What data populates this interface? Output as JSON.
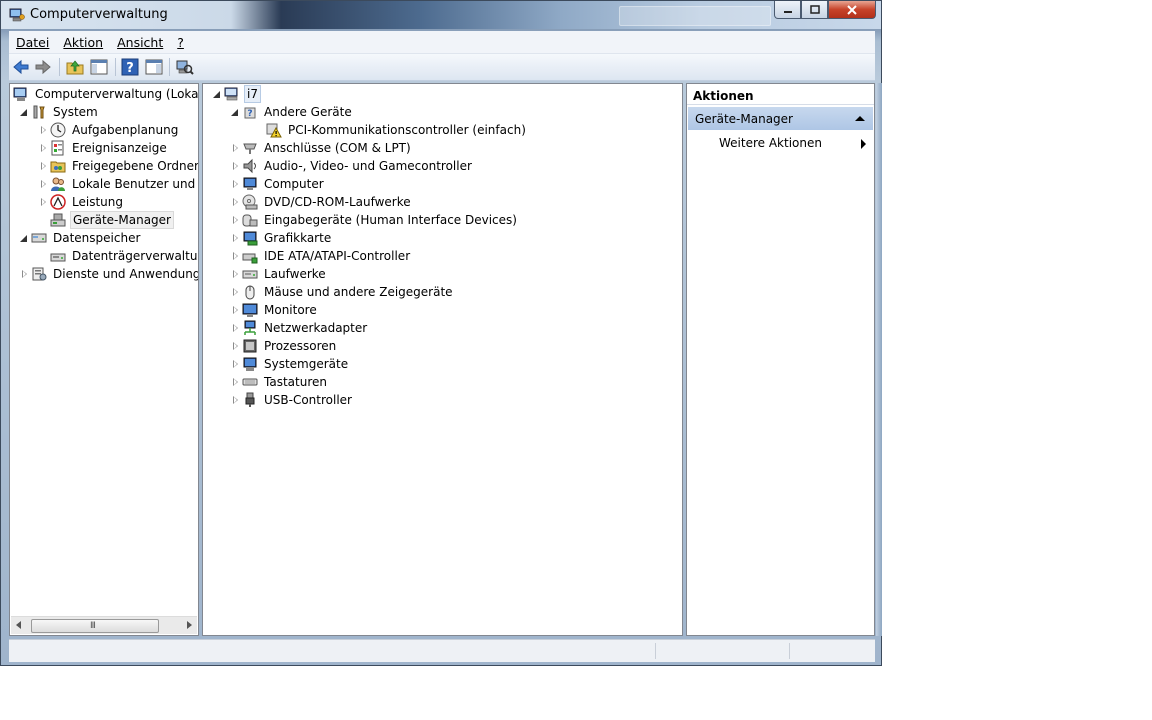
{
  "window": {
    "title": "Computerverwaltung"
  },
  "menu": [
    {
      "label": "Datei"
    },
    {
      "label": "Aktion"
    },
    {
      "label": "Ansicht"
    },
    {
      "label": "?"
    }
  ],
  "toolbar": {
    "icons": [
      "back-arrow-icon",
      "forward-arrow-icon",
      "up-folder-icon",
      "show-hide-tree-icon",
      "help-icon",
      "show-hide-action-pane-icon",
      "scan-hardware-icon"
    ]
  },
  "left_tree": {
    "root": "Computerverwaltung (Lokal)",
    "system": "System",
    "aufgabenplanung": "Aufgabenplanung",
    "ereignisanzeige": "Ereignisanzeige",
    "freigegebene": "Freigegebene Ordner",
    "benutzer": "Lokale Benutzer und Gruppen",
    "leistung": "Leistung",
    "geraete": "Geräte-Manager",
    "datenspeicher": "Datenspeicher",
    "datentraeger": "Datenträgerverwaltung",
    "dienste": "Dienste und Anwendungen"
  },
  "device_tree": {
    "root": "i7",
    "andere": "Andere Geräte",
    "pci": "PCI-Kommunikationscontroller (einfach)",
    "categories": [
      "Anschlüsse (COM & LPT)",
      "Audio-, Video- und Gamecontroller",
      "Computer",
      "DVD/CD-ROM-Laufwerke",
      "Eingabegeräte (Human Interface Devices)",
      "Grafikkarte",
      "IDE ATA/ATAPI-Controller",
      "Laufwerke",
      "Mäuse und andere Zeigegeräte",
      "Monitore",
      "Netzwerkadapter",
      "Prozessoren",
      "Systemgeräte",
      "Tastaturen",
      "USB-Controller"
    ]
  },
  "actions": {
    "header": "Aktionen",
    "group": "Geräte-Manager",
    "item": "Weitere Aktionen"
  },
  "scrollbar": {
    "grip": "III"
  },
  "colors": {
    "selection_blue": "#aec6e5",
    "toolbar_blue": "#3e7bd1"
  }
}
